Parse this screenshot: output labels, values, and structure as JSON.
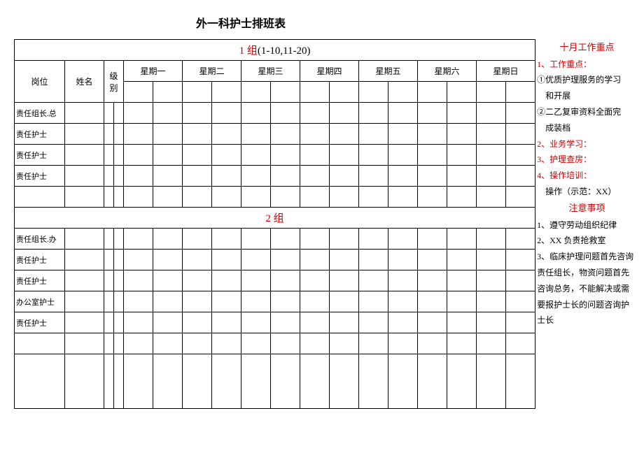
{
  "title": "外一科护士排班表",
  "group1": {
    "header_prefix": "1 组",
    "header_suffix": "(1-10,11-20)",
    "columns": {
      "position": "岗位",
      "name": "姓名",
      "level": "级别"
    },
    "days": [
      "星期一",
      "星期二",
      "星期三",
      "星期四",
      "星期五",
      "星期六",
      "星期日"
    ],
    "rows": [
      "责任组长.总",
      "责任护士",
      "责任护士",
      "责任护士"
    ]
  },
  "group2": {
    "header": "2 组",
    "rows": [
      "责任组长.办",
      "责任护士",
      "责任护士",
      "办公室护士",
      "责任护士"
    ]
  },
  "focus": {
    "title": "十月工作重点",
    "item1_label": "1、工作重点：",
    "item1_a": "①优质护理服务的学习",
    "item1_a2": "和开展",
    "item1_b": "②二乙复审资料全面完",
    "item1_b2": "成装档",
    "item2_label": "2、业务学习：",
    "item3_label": "3、护理查房：",
    "item4_label": "4、操作培训：",
    "item4_a": "操作（示范：XX）"
  },
  "notice": {
    "title": "注意事项",
    "n1": "1、遵守劳动组织纪律",
    "n2": "2、XX 负责抢救室",
    "n3": "3、临床护理问题首先咨询责任组长，物资问题首先咨询总务，不能解决或需要报护士长的问题咨询护士长"
  }
}
